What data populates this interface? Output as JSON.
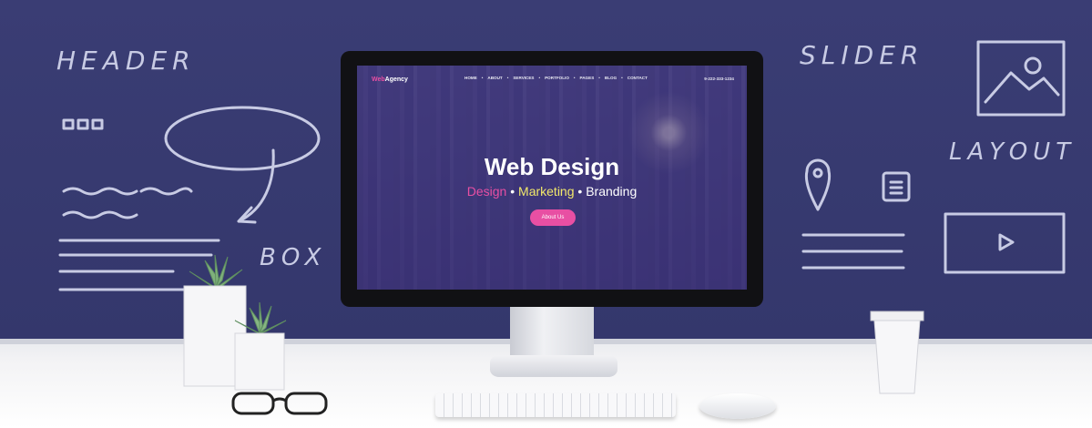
{
  "wall_labels": {
    "header": "HEADER",
    "box": "BOX",
    "slider": "SLIDER",
    "layout": "LAYOUT"
  },
  "website": {
    "brand_pre": "Web",
    "brand_post": "Agency",
    "nav": [
      "HOME",
      "•",
      "ABOUT",
      "•",
      "SERVICES",
      "•",
      "PORTFOLIO",
      "•",
      "PAGES",
      "•",
      "BLOG",
      "•",
      "CONTACT"
    ],
    "phone": "9-222-333-1234",
    "hero_title": "Web Design",
    "hero_sub_1": "Design",
    "hero_sep_1": " • ",
    "hero_sub_2": "Marketing",
    "hero_sep_2": " • ",
    "hero_sub_3": "Branding",
    "cta": "About Us"
  },
  "colors": {
    "wall": "#3a3d74",
    "accent_pink": "#e84fa3",
    "accent_yellow": "#f2e86a",
    "chalk": "#c8cbe4"
  }
}
